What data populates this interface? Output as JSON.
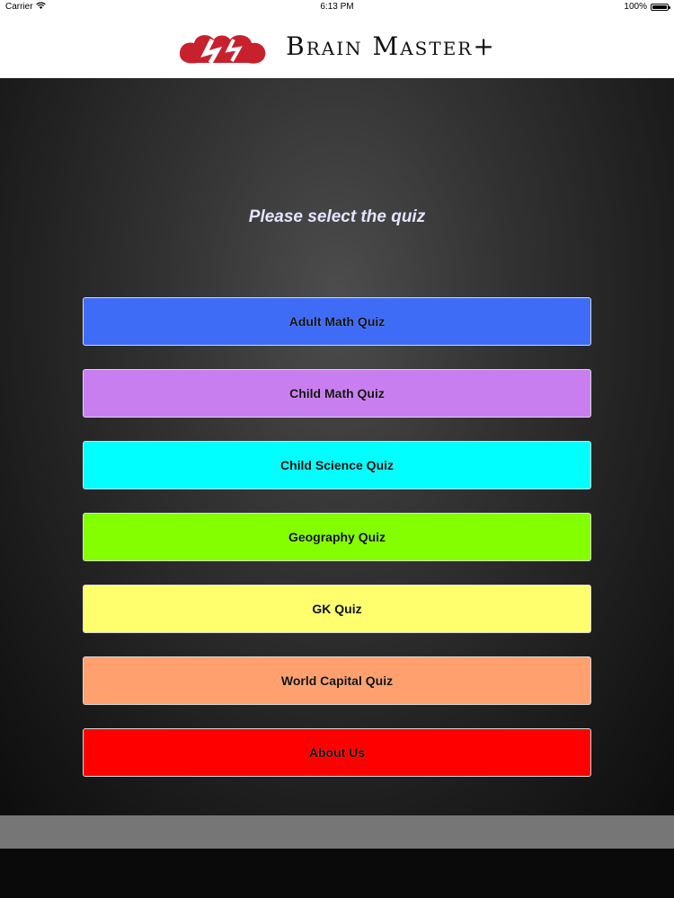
{
  "status_bar": {
    "carrier": "Carrier",
    "time": "6:13 PM",
    "battery": "100%",
    "battery_level": 1.0,
    "wifi_icon": "wifi-icon",
    "battery_icon": "battery-icon"
  },
  "header": {
    "title": "Brain Master+",
    "logo_icon": "brain-logo-icon",
    "logo_color": "#c8202c"
  },
  "main": {
    "prompt": "Please select the quiz",
    "buttons": [
      {
        "label": "Adult Math Quiz",
        "color": "#3f6cf7"
      },
      {
        "label": "Child Math Quiz",
        "color": "#c97ef0"
      },
      {
        "label": "Child Science Quiz",
        "color": "#00ffff"
      },
      {
        "label": "Geography Quiz",
        "color": "#84ff00"
      },
      {
        "label": "GK Quiz",
        "color": "#ffff6e"
      },
      {
        "label": "World Capital Quiz",
        "color": "#ffa06e"
      },
      {
        "label": "About Us",
        "color": "#ff0000"
      }
    ]
  }
}
